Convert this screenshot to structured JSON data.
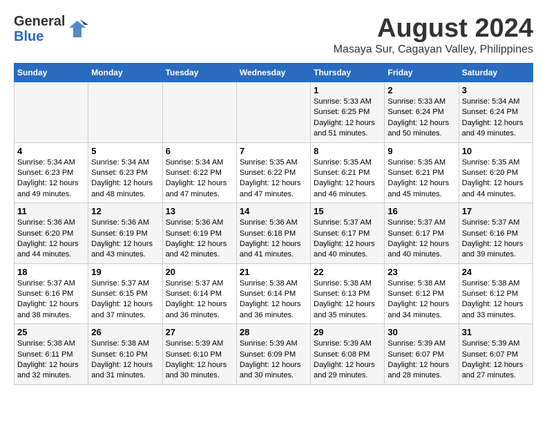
{
  "header": {
    "logo_general": "General",
    "logo_blue": "Blue",
    "title": "August 2024",
    "subtitle": "Masaya Sur, Cagayan Valley, Philippines"
  },
  "columns": [
    "Sunday",
    "Monday",
    "Tuesday",
    "Wednesday",
    "Thursday",
    "Friday",
    "Saturday"
  ],
  "weeks": [
    [
      {
        "day": "",
        "content": ""
      },
      {
        "day": "",
        "content": ""
      },
      {
        "day": "",
        "content": ""
      },
      {
        "day": "",
        "content": ""
      },
      {
        "day": "1",
        "content": "Sunrise: 5:33 AM\nSunset: 6:25 PM\nDaylight: 12 hours\nand 51 minutes."
      },
      {
        "day": "2",
        "content": "Sunrise: 5:33 AM\nSunset: 6:24 PM\nDaylight: 12 hours\nand 50 minutes."
      },
      {
        "day": "3",
        "content": "Sunrise: 5:34 AM\nSunset: 6:24 PM\nDaylight: 12 hours\nand 49 minutes."
      }
    ],
    [
      {
        "day": "4",
        "content": "Sunrise: 5:34 AM\nSunset: 6:23 PM\nDaylight: 12 hours\nand 49 minutes."
      },
      {
        "day": "5",
        "content": "Sunrise: 5:34 AM\nSunset: 6:23 PM\nDaylight: 12 hours\nand 48 minutes."
      },
      {
        "day": "6",
        "content": "Sunrise: 5:34 AM\nSunset: 6:22 PM\nDaylight: 12 hours\nand 47 minutes."
      },
      {
        "day": "7",
        "content": "Sunrise: 5:35 AM\nSunset: 6:22 PM\nDaylight: 12 hours\nand 47 minutes."
      },
      {
        "day": "8",
        "content": "Sunrise: 5:35 AM\nSunset: 6:21 PM\nDaylight: 12 hours\nand 46 minutes."
      },
      {
        "day": "9",
        "content": "Sunrise: 5:35 AM\nSunset: 6:21 PM\nDaylight: 12 hours\nand 45 minutes."
      },
      {
        "day": "10",
        "content": "Sunrise: 5:35 AM\nSunset: 6:20 PM\nDaylight: 12 hours\nand 44 minutes."
      }
    ],
    [
      {
        "day": "11",
        "content": "Sunrise: 5:36 AM\nSunset: 6:20 PM\nDaylight: 12 hours\nand 44 minutes."
      },
      {
        "day": "12",
        "content": "Sunrise: 5:36 AM\nSunset: 6:19 PM\nDaylight: 12 hours\nand 43 minutes."
      },
      {
        "day": "13",
        "content": "Sunrise: 5:36 AM\nSunset: 6:19 PM\nDaylight: 12 hours\nand 42 minutes."
      },
      {
        "day": "14",
        "content": "Sunrise: 5:36 AM\nSunset: 6:18 PM\nDaylight: 12 hours\nand 41 minutes."
      },
      {
        "day": "15",
        "content": "Sunrise: 5:37 AM\nSunset: 6:17 PM\nDaylight: 12 hours\nand 40 minutes."
      },
      {
        "day": "16",
        "content": "Sunrise: 5:37 AM\nSunset: 6:17 PM\nDaylight: 12 hours\nand 40 minutes."
      },
      {
        "day": "17",
        "content": "Sunrise: 5:37 AM\nSunset: 6:16 PM\nDaylight: 12 hours\nand 39 minutes."
      }
    ],
    [
      {
        "day": "18",
        "content": "Sunrise: 5:37 AM\nSunset: 6:16 PM\nDaylight: 12 hours\nand 38 minutes."
      },
      {
        "day": "19",
        "content": "Sunrise: 5:37 AM\nSunset: 6:15 PM\nDaylight: 12 hours\nand 37 minutes."
      },
      {
        "day": "20",
        "content": "Sunrise: 5:37 AM\nSunset: 6:14 PM\nDaylight: 12 hours\nand 36 minutes."
      },
      {
        "day": "21",
        "content": "Sunrise: 5:38 AM\nSunset: 6:14 PM\nDaylight: 12 hours\nand 36 minutes."
      },
      {
        "day": "22",
        "content": "Sunrise: 5:38 AM\nSunset: 6:13 PM\nDaylight: 12 hours\nand 35 minutes."
      },
      {
        "day": "23",
        "content": "Sunrise: 5:38 AM\nSunset: 6:12 PM\nDaylight: 12 hours\nand 34 minutes."
      },
      {
        "day": "24",
        "content": "Sunrise: 5:38 AM\nSunset: 6:12 PM\nDaylight: 12 hours\nand 33 minutes."
      }
    ],
    [
      {
        "day": "25",
        "content": "Sunrise: 5:38 AM\nSunset: 6:11 PM\nDaylight: 12 hours\nand 32 minutes."
      },
      {
        "day": "26",
        "content": "Sunrise: 5:38 AM\nSunset: 6:10 PM\nDaylight: 12 hours\nand 31 minutes."
      },
      {
        "day": "27",
        "content": "Sunrise: 5:39 AM\nSunset: 6:10 PM\nDaylight: 12 hours\nand 30 minutes."
      },
      {
        "day": "28",
        "content": "Sunrise: 5:39 AM\nSunset: 6:09 PM\nDaylight: 12 hours\nand 30 minutes."
      },
      {
        "day": "29",
        "content": "Sunrise: 5:39 AM\nSunset: 6:08 PM\nDaylight: 12 hours\nand 29 minutes."
      },
      {
        "day": "30",
        "content": "Sunrise: 5:39 AM\nSunset: 6:07 PM\nDaylight: 12 hours\nand 28 minutes."
      },
      {
        "day": "31",
        "content": "Sunrise: 5:39 AM\nSunset: 6:07 PM\nDaylight: 12 hours\nand 27 minutes."
      }
    ]
  ]
}
